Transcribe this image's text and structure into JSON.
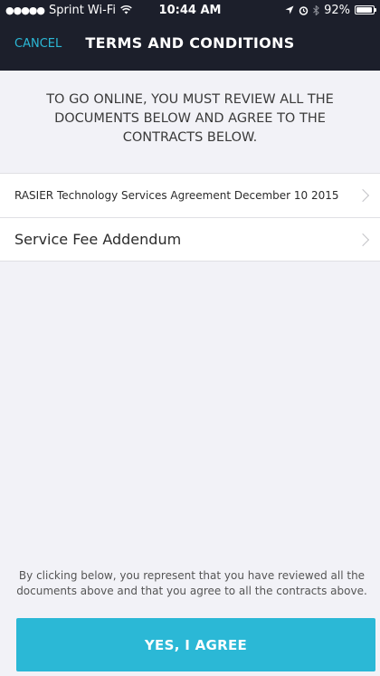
{
  "status_bar": {
    "signal": "●●●●●",
    "carrier": "Sprint Wi-Fi",
    "wifi_icon": "wifi-icon",
    "time": "10:44 AM",
    "location_icon": "location-arrow-icon",
    "alarm_icon": "alarm-icon",
    "bluetooth_icon": "bluetooth-icon",
    "battery_percent": "92%",
    "battery_level": 0.92
  },
  "nav": {
    "cancel_label": "CANCEL",
    "title": "TERMS AND CONDITIONS"
  },
  "intro": "TO GO ONLINE, YOU MUST REVIEW ALL THE DOCUMENTS BELOW AND AGREE TO THE CONTRACTS BELOW.",
  "documents": [
    {
      "label": "RASIER Technology Services Agreement December 10 2015"
    },
    {
      "label": "Service Fee Addendum"
    }
  ],
  "footer": {
    "notice": "By clicking below, you represent that you have reviewed all the documents above and that you agree to all the contracts above.",
    "agree_label": "YES, I AGREE"
  },
  "colors": {
    "nav_background": "#1c1f2b",
    "accent": "#2bb8d6",
    "background": "#f2f2f7"
  }
}
